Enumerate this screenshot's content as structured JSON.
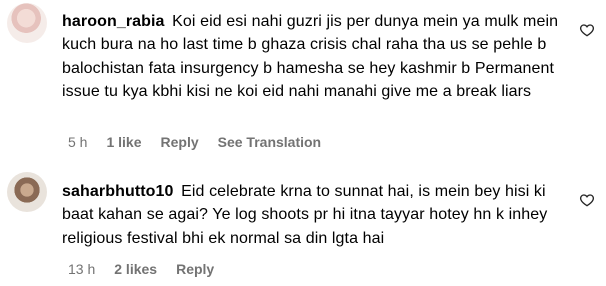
{
  "comments": [
    {
      "username": "haroon_rabia",
      "text": "Koi eid esi nahi guzri jis per dunya mein ya mulk mein kuch bura na ho last time b ghaza crisis chal raha tha us se pehle b balochistan fata insurgency b hamesha se hey kashmir b Permanent issue tu kya kbhi kisi ne koi eid nahi manahi give me a break liars",
      "time": "5 h",
      "likes": "1 like",
      "reply": "Reply",
      "translation": "See Translation"
    },
    {
      "username": "saharbhutto10",
      "text": "Eid celebrate krna to sunnat hai, is mein bey hisi ki baat kahan se agai? Ye log shoots pr hi itna tayyar hotey hn k inhey religious festival bhi ek normal sa din lgta hai",
      "time": "13 h",
      "likes": "2 likes",
      "reply": "Reply"
    }
  ],
  "icons": {
    "like": "heart-outline-icon"
  }
}
